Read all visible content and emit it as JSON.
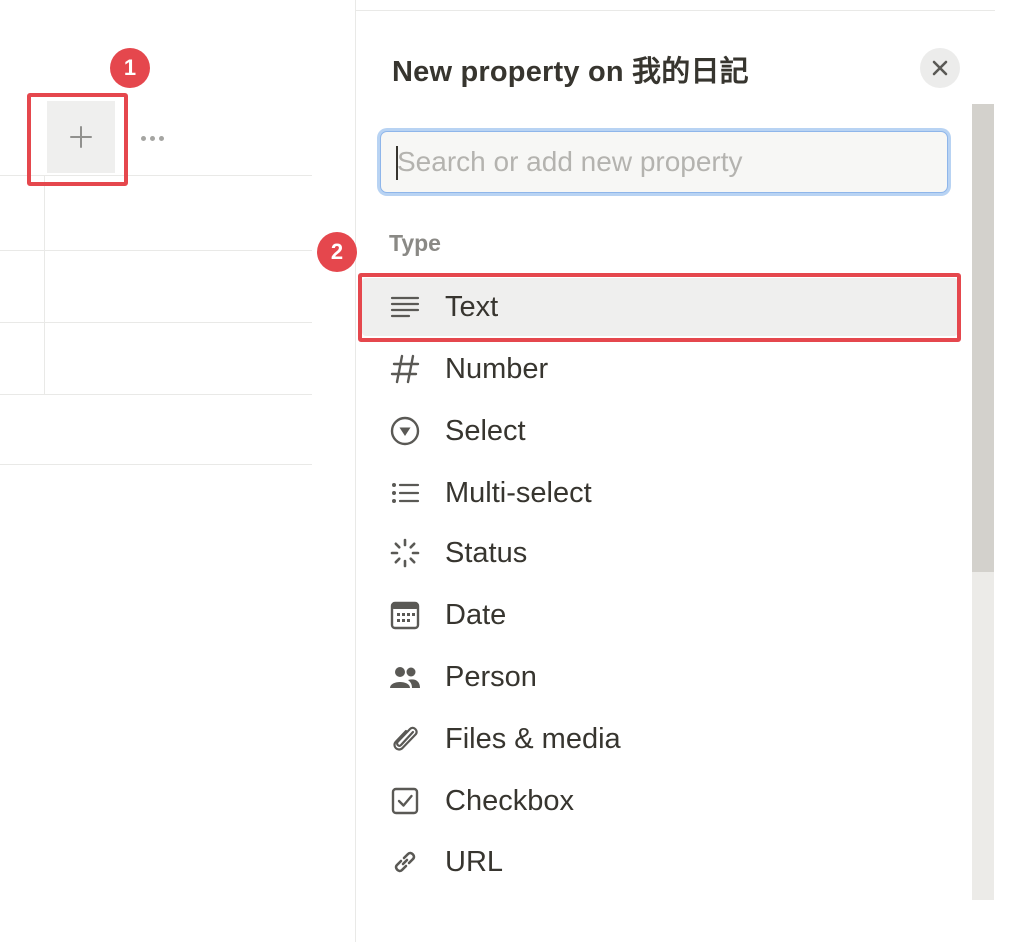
{
  "panel": {
    "title": "New property on 我的日記",
    "search_placeholder": "Search or add new property",
    "section_label": "Type"
  },
  "types": [
    {
      "label": "Text",
      "icon": "text-lines-icon",
      "selected": true
    },
    {
      "label": "Number",
      "icon": "hash-icon"
    },
    {
      "label": "Select",
      "icon": "select-circle-icon"
    },
    {
      "label": "Multi-select",
      "icon": "list-icon"
    },
    {
      "label": "Status",
      "icon": "status-loader-icon"
    },
    {
      "label": "Date",
      "icon": "calendar-icon"
    },
    {
      "label": "Person",
      "icon": "people-icon"
    },
    {
      "label": "Files & media",
      "icon": "paperclip-icon"
    },
    {
      "label": "Checkbox",
      "icon": "checkbox-icon"
    },
    {
      "label": "URL",
      "icon": "link-icon"
    }
  ],
  "annotations": [
    {
      "number": "1"
    },
    {
      "number": "2"
    }
  ],
  "colors": {
    "annotation_red": "#e5474d",
    "focus_ring": "#b8d3f3",
    "text": "#37352f",
    "muted": "#8a8985"
  }
}
